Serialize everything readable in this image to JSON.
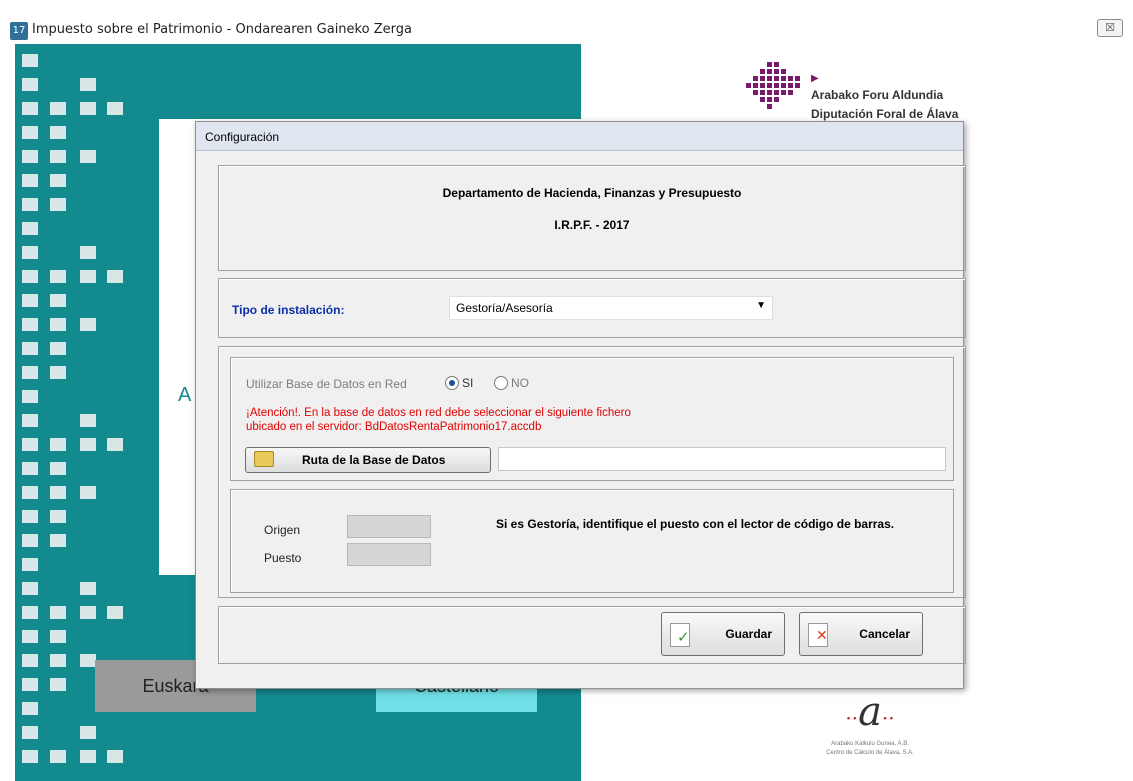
{
  "window": {
    "title": "Impuesto sobre el Patrimonio - Ondarearen Gaineko Zerga",
    "close_glyph": "☒"
  },
  "background": {
    "welcome_letter": "A",
    "lang_buttons": {
      "euskara": "Euskara",
      "castellano": "Castellano"
    },
    "logo_af": {
      "line1": "Arabako Foru Aldundia",
      "line2": "Diputación Foral de Álava"
    },
    "logo_cc": {
      "line1": "Arabako Kalkulu Gunea, A.B.",
      "line2": "Centro de Cálculo de Álava, S.A."
    },
    "colors": {
      "teal": "#138a8d",
      "tile": "#d8e6e7",
      "castellano": "#6fe0e6"
    }
  },
  "dialog": {
    "title": "Configuración",
    "header": {
      "department": "Departamento de Hacienda, Finanzas y Presupuesto",
      "tax": "I.R.P.F. - 2017"
    },
    "install": {
      "label": "Tipo de instalación:",
      "selected": "Gestoría/Asesoría"
    },
    "network": {
      "use_db_label": "Utilizar Base de Datos en Red",
      "option_si": "SI",
      "option_no": "NO",
      "selected": "SI",
      "warning_line1": "¡Atención!. En la base de datos en red debe seleccionar el siguiente fichero",
      "warning_line2": "ubicado en el servidor: BdDatosRentaPatrimonio17.accdb",
      "route_button": "Ruta de la Base de Datos",
      "route_value": ""
    },
    "identification": {
      "origen_label": "Origen",
      "puesto_label": "Puesto",
      "origen_value": "",
      "puesto_value": "",
      "hint": "Si es Gestoría, identifique el puesto con el lector de código de barras."
    },
    "actions": {
      "save": "Guardar",
      "cancel": "Cancelar"
    }
  }
}
